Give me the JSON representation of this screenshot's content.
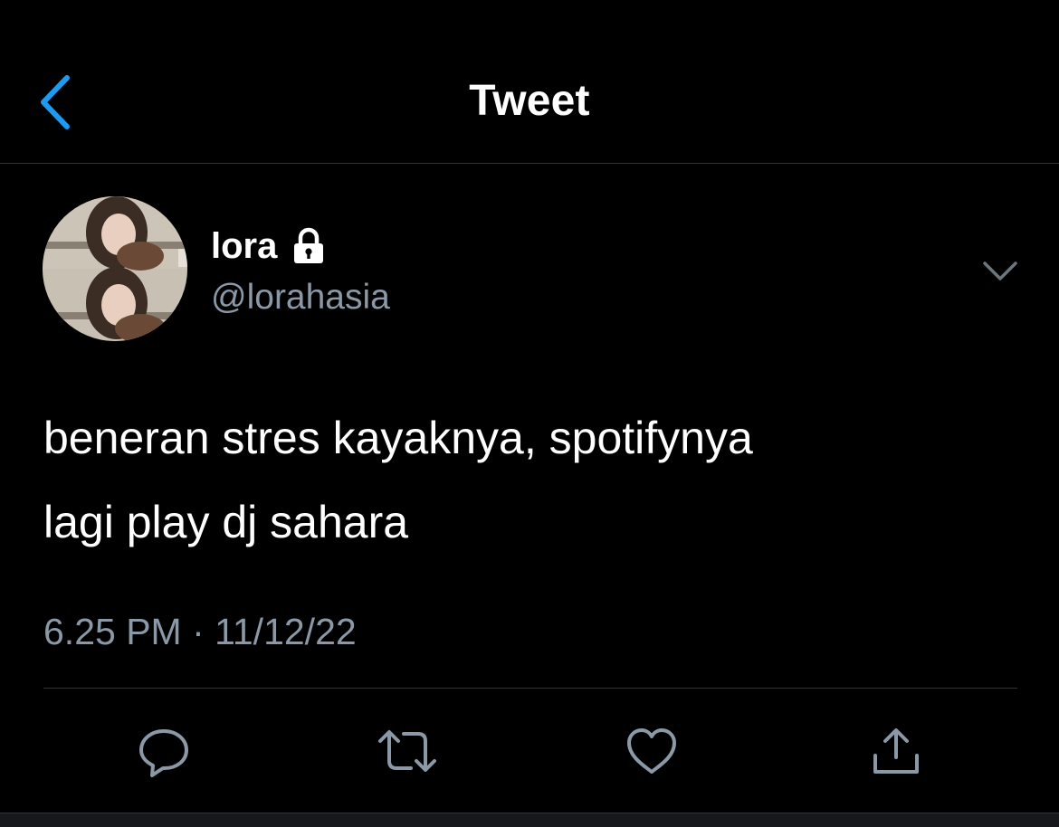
{
  "header": {
    "title": "Tweet",
    "back_icon": "chevron-left-icon",
    "accent_color": "#1d9bf0"
  },
  "author": {
    "display_name": "lora",
    "handle": "@lorahasia",
    "protected_icon": "lock-icon",
    "avatar": "profile-photo"
  },
  "tweet": {
    "text_line1": "beneran stres kayaknya, spotifynya",
    "text_line2": "lagi play dj sahara",
    "timestamp": "6.25 PM · 11/12/22"
  },
  "actions": [
    {
      "name": "reply",
      "icon": "comment-icon"
    },
    {
      "name": "retweet",
      "icon": "retweet-icon"
    },
    {
      "name": "like",
      "icon": "heart-icon"
    },
    {
      "name": "share",
      "icon": "share-icon"
    }
  ],
  "colors": {
    "background": "#000000",
    "text_primary": "#ffffff",
    "text_secondary": "#8b98a5",
    "divider": "#2f3336"
  }
}
